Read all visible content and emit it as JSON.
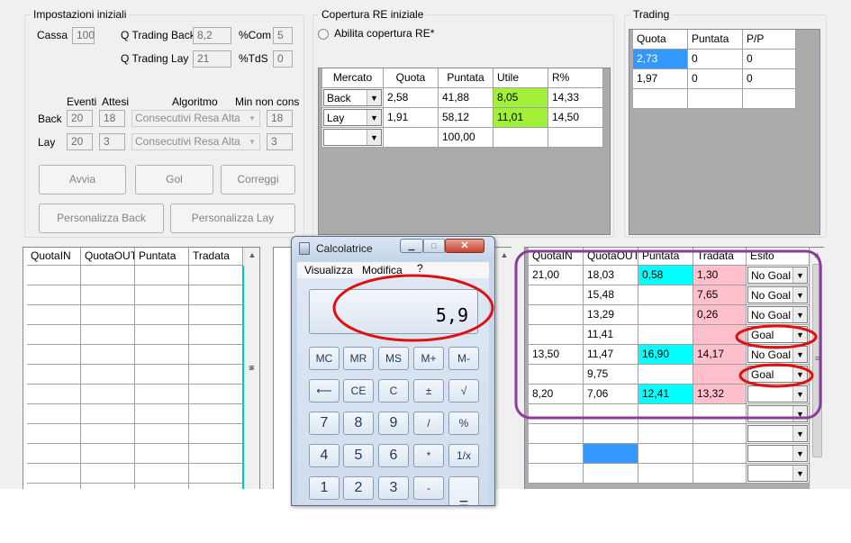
{
  "impostazioni": {
    "title": "Impostazioni iniziali",
    "cassa_label": "Cassa",
    "cassa_value": "100",
    "qback_label": "Q Trading Back",
    "qback_value": "8,2",
    "com_label": "%Com",
    "com_value": "5",
    "qlay_label": "Q Trading Lay",
    "qlay_value": "21",
    "tds_label": "%TdS",
    "tds_value": "0",
    "headers": {
      "eventi": "Eventi",
      "attesi": "Attesi",
      "algoritmo": "Algoritmo",
      "min_non_cons": "Min non cons"
    },
    "back_row": {
      "label": "Back",
      "eventi": "20",
      "attesi": "18",
      "algoritmo": "Consecutivi Resa Alta",
      "min": "18"
    },
    "lay_row": {
      "label": "Lay",
      "eventi": "20",
      "attesi": "3",
      "algoritmo": "Consecutivi Resa Alta",
      "min": "3"
    },
    "buttons": {
      "avvia": "Avvia",
      "gol": "Gol",
      "correggi": "Correggi",
      "pers_back": "Personalizza Back",
      "pers_lay": "Personalizza Lay"
    }
  },
  "copertura": {
    "title": "Copertura RE iniziale",
    "radio_label": "Abilita copertura RE*",
    "headers": [
      "Mercato",
      "Quota",
      "Puntata",
      "Utile",
      "R%"
    ],
    "rows": [
      {
        "mercato": "Back",
        "quota": "2,58",
        "puntata": "41,88",
        "utile": "8,05",
        "r": "14,33"
      },
      {
        "mercato": "Lay",
        "quota": "1,91",
        "puntata": "58,12",
        "utile": "11,01",
        "r": "14,50"
      },
      {
        "mercato": "",
        "quota": "",
        "puntata": "100,00",
        "utile": "",
        "r": ""
      }
    ]
  },
  "trading": {
    "title": "Trading",
    "headers": [
      "Quota",
      "Puntata",
      "P/P"
    ],
    "rows": [
      {
        "quota": "2,73",
        "puntata": "0",
        "pp": "0"
      },
      {
        "quota": "1,97",
        "puntata": "0",
        "pp": "0"
      }
    ]
  },
  "left_grid": {
    "headers": [
      "QuotaIN",
      "QuotaOUT",
      "Puntata",
      "Tradata"
    ]
  },
  "right_grid": {
    "headers": [
      "QuotaIN",
      "QuotaOUT",
      "Puntata",
      "Tradata",
      "Esito"
    ],
    "rows": [
      {
        "quotain": "21,00",
        "quotaout": "18,03",
        "puntata": "0,58",
        "tradata": "1,30",
        "esito": "No Goal"
      },
      {
        "quotain": "",
        "quotaout": "15,48",
        "puntata": "",
        "tradata": "7,65",
        "esito": "No Goal"
      },
      {
        "quotain": "",
        "quotaout": "13,29",
        "puntata": "",
        "tradata": "0,26",
        "esito": "No Goal"
      },
      {
        "quotain": "",
        "quotaout": "11,41",
        "puntata": "",
        "tradata": "",
        "esito": "Goal"
      },
      {
        "quotain": "13,50",
        "quotaout": "11,47",
        "puntata": "16,90",
        "tradata": "14,17",
        "esito": "No Goal"
      },
      {
        "quotain": "",
        "quotaout": "9,75",
        "puntata": "",
        "tradata": "",
        "esito": "Goal"
      },
      {
        "quotain": "8,20",
        "quotaout": "7,06",
        "puntata": "12,41",
        "tradata": "13,32",
        "esito": ""
      },
      {
        "quotain": "",
        "quotaout": "",
        "puntata": "",
        "tradata": "",
        "esito": ""
      },
      {
        "quotain": "",
        "quotaout": "",
        "puntata": "",
        "tradata": "",
        "esito": ""
      },
      {
        "quotain": "",
        "quotaout": "",
        "puntata": "",
        "tradata": "",
        "esito": ""
      },
      {
        "quotain": "",
        "quotaout": "",
        "puntata": "",
        "tradata": "",
        "esito": ""
      }
    ]
  },
  "calculator": {
    "title": "Calcolatrice",
    "menu": [
      "Visualizza",
      "Modifica",
      "?"
    ],
    "display": "5,9",
    "rows": [
      [
        "MC",
        "MR",
        "MS",
        "M+",
        "M-"
      ],
      [
        "⟵",
        "CE",
        "C",
        "±",
        "√"
      ],
      [
        "7",
        "8",
        "9",
        "/",
        "%"
      ],
      [
        "4",
        "5",
        "6",
        "*",
        "1/x"
      ],
      [
        "1",
        "2",
        "3",
        "-",
        "="
      ]
    ]
  },
  "colors": {
    "cyan": "#00ffff",
    "pink": "#ffc0cb",
    "green": "#a3f03a",
    "selection": "#3399ff",
    "annotation_red": "#e01010",
    "annotation_purple": "#8e3a9d"
  }
}
